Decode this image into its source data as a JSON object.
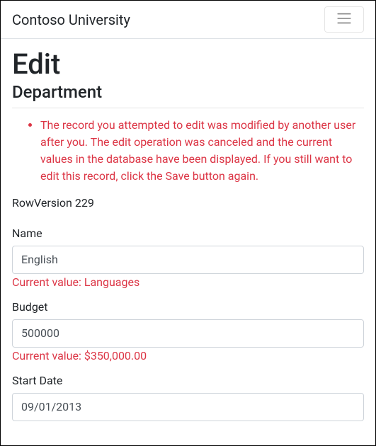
{
  "navbar": {
    "brand": "Contoso University"
  },
  "page": {
    "title": "Edit",
    "subtitle": "Department"
  },
  "validation": {
    "summary": "The record you attempted to edit was modified by another user after you. The edit operation was canceled and the current values in the database have been displayed. If you still want to edit this record, click the Save button again."
  },
  "rowversion": {
    "label": "RowVersion",
    "value": "229"
  },
  "form": {
    "name": {
      "label": "Name",
      "value": "English",
      "currentValue": "Current value: Languages"
    },
    "budget": {
      "label": "Budget",
      "value": "500000",
      "currentValue": "Current value: $350,000.00"
    },
    "startDate": {
      "label": "Start Date",
      "value": "09/01/2013"
    }
  }
}
